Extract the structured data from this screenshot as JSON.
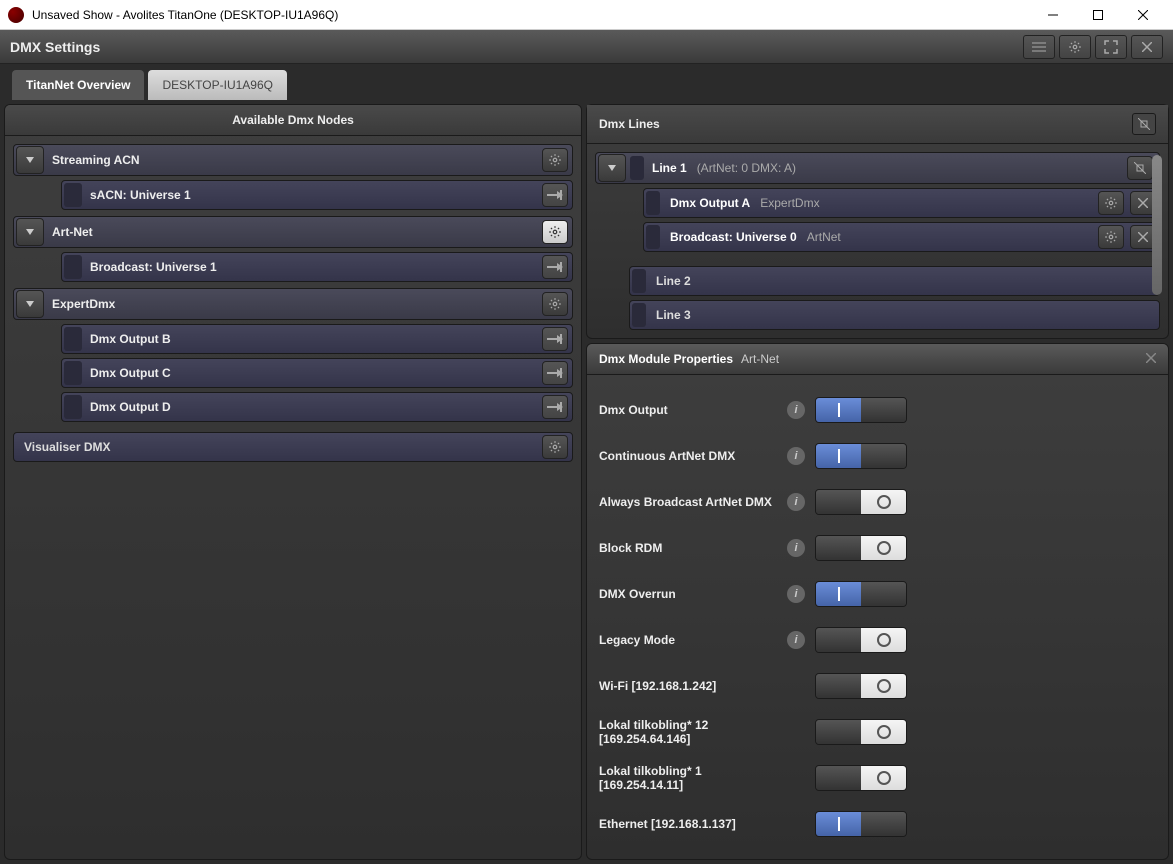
{
  "window_title": "Unsaved Show - Avolites TitanOne (DESKTOP-IU1A96Q)",
  "header": {
    "title": "DMX Settings"
  },
  "tabs": [
    {
      "label": "TitanNet Overview",
      "active": true
    },
    {
      "label": "DESKTOP-IU1A96Q",
      "active": false
    }
  ],
  "left": {
    "title": "Available Dmx Nodes",
    "groups": [
      {
        "name": "Streaming ACN",
        "gear_bright": false,
        "items": [
          {
            "label": "sACN: Universe 1"
          }
        ]
      },
      {
        "name": "Art-Net",
        "gear_bright": true,
        "items": [
          {
            "label": "Broadcast: Universe 1"
          }
        ]
      },
      {
        "name": "ExpertDmx",
        "gear_bright": false,
        "items": [
          {
            "label": "Dmx Output B"
          },
          {
            "label": "Dmx Output C"
          },
          {
            "label": "Dmx Output D"
          }
        ]
      }
    ],
    "simple": {
      "label": "Visualiser DMX"
    }
  },
  "lines": {
    "title": "Dmx Lines",
    "line1": {
      "label": "Line 1",
      "sub": "(ArtNet: 0 DMX: A)",
      "children": [
        {
          "primary": "Dmx Output A",
          "secondary": "ExpertDmx"
        },
        {
          "primary": "Broadcast: Universe 0",
          "secondary": "ArtNet"
        }
      ]
    },
    "others": [
      {
        "label": "Line 2"
      },
      {
        "label": "Line 3"
      }
    ]
  },
  "props": {
    "title": "Dmx Module Properties",
    "subtitle": "Art-Net",
    "rows": [
      {
        "label": "Dmx Output",
        "info": true,
        "on": true
      },
      {
        "label": "Continuous ArtNet DMX",
        "info": true,
        "on": true
      },
      {
        "label": "Always Broadcast ArtNet DMX",
        "info": true,
        "on": false
      },
      {
        "label": "Block RDM",
        "info": true,
        "on": false
      },
      {
        "label": "DMX Overrun",
        "info": true,
        "on": true
      },
      {
        "label": "Legacy Mode",
        "info": true,
        "on": false
      },
      {
        "label": "Wi-Fi [192.168.1.242]",
        "info": false,
        "on": false
      },
      {
        "label": "Lokal tilkobling* 12 [169.254.64.146]",
        "info": false,
        "on": false
      },
      {
        "label": "Lokal tilkobling* 1 [169.254.14.11]",
        "info": false,
        "on": false
      },
      {
        "label": "Ethernet [192.168.1.137]",
        "info": false,
        "on": true
      }
    ]
  }
}
